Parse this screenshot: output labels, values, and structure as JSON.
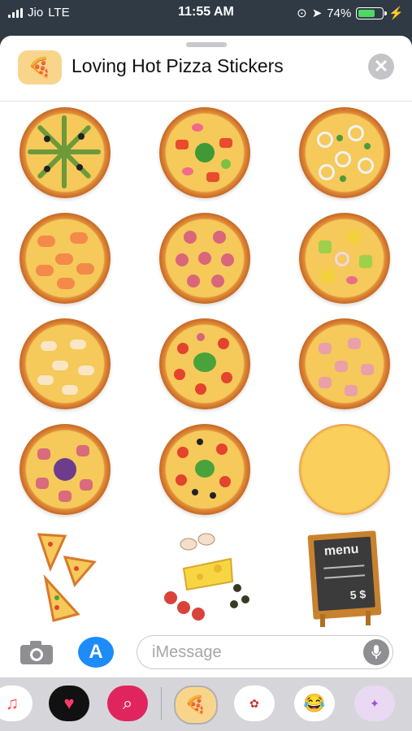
{
  "status_bar": {
    "carrier": "Jio",
    "network": "LTE",
    "time": "11:55 AM",
    "battery_percent": "74%",
    "battery_level": 0.74
  },
  "sheet": {
    "title": "Loving Hot Pizza Stickers",
    "close_label": "✕"
  },
  "stickers": [
    {
      "name": "pizza-veggie-olive"
    },
    {
      "name": "pizza-pepper-onion"
    },
    {
      "name": "pizza-onion-ring"
    },
    {
      "name": "pizza-shrimp"
    },
    {
      "name": "pizza-salami"
    },
    {
      "name": "pizza-pepper-onion-2"
    },
    {
      "name": "pizza-chicken"
    },
    {
      "name": "pizza-tomato-basil"
    },
    {
      "name": "pizza-ham"
    },
    {
      "name": "pizza-ham-basil"
    },
    {
      "name": "pizza-margherita-olive"
    },
    {
      "name": "pizza-cheese-plain"
    },
    {
      "name": "pizza-slices"
    },
    {
      "name": "cheese-mushroom-ingredients"
    },
    {
      "name": "menu-board"
    }
  ],
  "menu_board": {
    "label": "menu",
    "price": "5 $"
  },
  "input_bar": {
    "placeholder": "iMessage"
  },
  "colors": {
    "accent": "#1d8cf8",
    "battery": "#4cd964"
  }
}
